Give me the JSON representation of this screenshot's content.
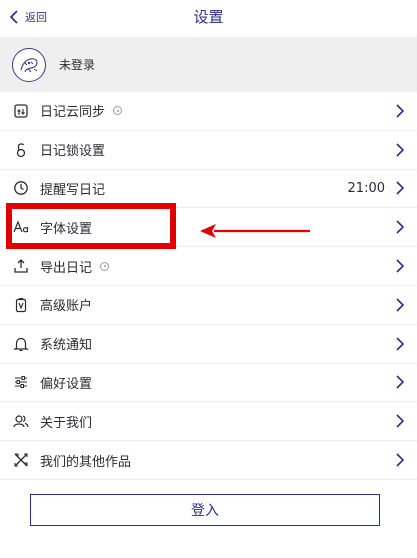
{
  "nav": {
    "back_label": "返回",
    "title": "设置"
  },
  "profile": {
    "name": "未登录"
  },
  "menu": {
    "items": [
      {
        "label": "日记云同步",
        "icon": "cloud-sync-icon"
      },
      {
        "label": "日记锁设置",
        "icon": "lock-icon"
      },
      {
        "label": "提醒写日记",
        "icon": "clock-icon",
        "value": "21:00"
      },
      {
        "label": "字体设置",
        "icon": "font-icon"
      },
      {
        "label": "导出日记",
        "icon": "export-icon"
      },
      {
        "label": "高级账户",
        "icon": "premium-icon"
      },
      {
        "label": "系统通知",
        "icon": "bell-icon"
      },
      {
        "label": "偏好设置",
        "icon": "sliders-icon"
      },
      {
        "label": "关于我们",
        "icon": "people-icon"
      },
      {
        "label": "我们的其他作品",
        "icon": "tools-icon"
      }
    ]
  },
  "login": {
    "label": "登入"
  },
  "colors": {
    "accent": "#2d2d8c",
    "highlight": "#e00000",
    "profile_bg": "#efefef"
  }
}
